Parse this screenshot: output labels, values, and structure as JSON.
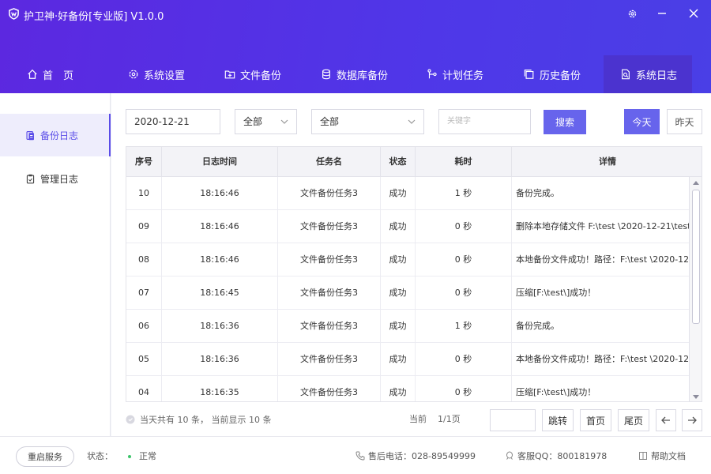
{
  "app": {
    "title": "护卫神·好备份[专业版]  V1.0.0"
  },
  "nav": [
    {
      "label": "首　页",
      "icon": "home-icon"
    },
    {
      "label": "系统设置",
      "icon": "gear-icon"
    },
    {
      "label": "文件备份",
      "icon": "folder-plus-icon"
    },
    {
      "label": "数据库备份",
      "icon": "database-icon"
    },
    {
      "label": "计划任务",
      "icon": "schedule-icon"
    },
    {
      "label": "历史备份",
      "icon": "history-icon"
    },
    {
      "label": "系统日志",
      "icon": "log-search-icon",
      "active": true
    }
  ],
  "sidebar": [
    {
      "label": "备份日志",
      "active": true,
      "icon": "backup-log-icon"
    },
    {
      "label": "管理日志",
      "active": false,
      "icon": "manage-log-icon"
    }
  ],
  "filters": {
    "date": "2020-12-21",
    "type_select": "全部",
    "task_select": "全部",
    "keyword_placeholder": "关键字",
    "search_label": "搜索",
    "today_label": "今天",
    "yesterday_label": "昨天"
  },
  "table": {
    "headers": [
      "序号",
      "日志时间",
      "任务名",
      "状态",
      "耗时",
      "详情"
    ],
    "rows": [
      [
        "10",
        "18:16:46",
        "文件备份任务3",
        "成功",
        "1 秒",
        "备份完成。"
      ],
      [
        "09",
        "18:16:46",
        "文件备份任务3",
        "成功",
        "0 秒",
        "删除本地存储文件 F:\\test  \\2020-12-21\\test_"
      ],
      [
        "08",
        "18:16:46",
        "文件备份任务3",
        "成功",
        "0 秒",
        "本地备份文件成功！路径：F:\\test  \\2020-12-"
      ],
      [
        "07",
        "18:16:45",
        "文件备份任务3",
        "成功",
        "0 秒",
        "压缩[F:\\test\\]成功！"
      ],
      [
        "06",
        "18:16:36",
        "文件备份任务3",
        "成功",
        "1 秒",
        "备份完成。"
      ],
      [
        "05",
        "18:16:36",
        "文件备份任务3",
        "成功",
        "0 秒",
        "本地备份文件成功！路径：F:\\test  \\2020-12-"
      ],
      [
        "04",
        "18:16:35",
        "文件备份任务3",
        "成功",
        "0 秒",
        "压缩[F:\\test\\]成功！"
      ]
    ]
  },
  "pagination": {
    "summary": "当天共有 10 条，  当前显示 10 条",
    "current_label": "当前",
    "page": "1/1页",
    "jump_label": "跳转",
    "first_label": "首页",
    "last_label": "尾页"
  },
  "footer": {
    "restart_label": "重启服务",
    "status_label": "状态：",
    "status_value": "正常",
    "phone": "售后电话：028-89549999",
    "qq": "客服QQ：800181978",
    "help": "帮助文档"
  },
  "colors": {
    "accent": "#6764ec",
    "header": "#5232e4",
    "status_ok": "#3cc46a"
  }
}
